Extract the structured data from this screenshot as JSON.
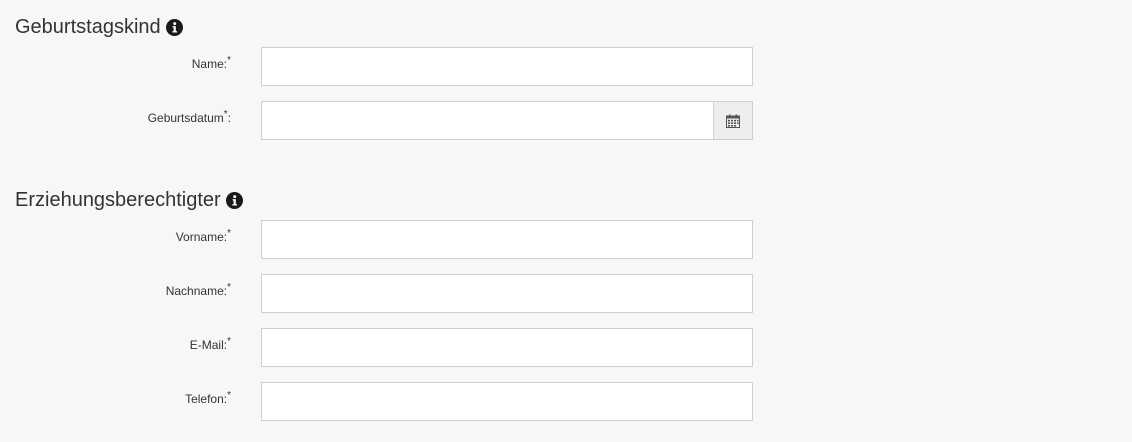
{
  "sections": {
    "child": {
      "title": "Geburtstagskind",
      "info_icon": "info-circle-icon",
      "fields": {
        "name": {
          "label": "Name:",
          "required_mark": "*",
          "value": ""
        },
        "birthdate": {
          "label_before": "Geburtsdatum",
          "required_mark": "*",
          "label_after": ":",
          "value": "",
          "addon_icon": "calendar-icon"
        }
      }
    },
    "guardian": {
      "title": "Erziehungsberechtigter",
      "info_icon": "info-circle-icon",
      "fields": {
        "first_name": {
          "label": "Vorname:",
          "required_mark": "*",
          "value": ""
        },
        "last_name": {
          "label": "Nachname:",
          "required_mark": "*",
          "value": ""
        },
        "email": {
          "label": "E-Mail:",
          "required_mark": "*",
          "value": ""
        },
        "phone": {
          "label": "Telefon:",
          "required_mark": "*",
          "value": ""
        }
      }
    }
  },
  "colors": {
    "page_background": "#f7f7f7",
    "text": "#333333",
    "field_border": "#cfcfcf",
    "addon_background": "#eeeeee"
  }
}
